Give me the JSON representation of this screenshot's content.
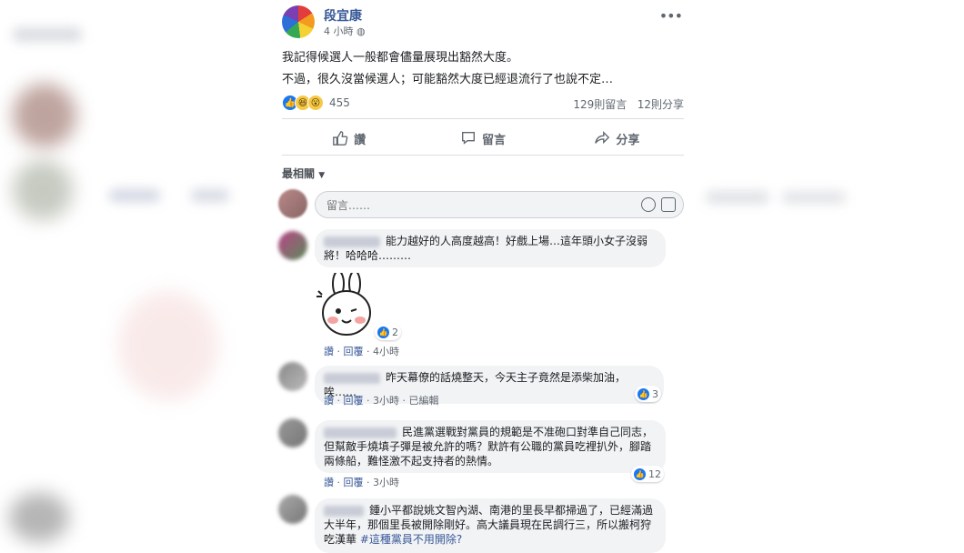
{
  "post": {
    "page_name": "段宜康",
    "time": "4 小時",
    "line1": "我記得候選人一般都會儘量展現出豁然大度。",
    "line2": "不過，很久沒當候選人；可能豁然大度已經退流行了也說不定…",
    "reaction_count": "455",
    "comments_count": "129則留言",
    "shares_count": "12則分享"
  },
  "actions": {
    "like": "讚",
    "comment": "留言",
    "share": "分享"
  },
  "sort_label": "最相關",
  "composer": {
    "placeholder": "留言……"
  },
  "comments": [
    {
      "text": "能力越好的人高度越高！好戲上場…這年頭小女子沒弱將！哈哈哈………",
      "sticker": true,
      "likes": "2",
      "like": "讚",
      "reply": "回覆",
      "time": "4小時"
    },
    {
      "text": "昨天幕僚的話燒整天，今天主子竟然是添柴加油，唉……",
      "likes": "3",
      "like": "讚",
      "reply": "回覆",
      "time": "3小時",
      "edited": "已編輯"
    },
    {
      "text": "民進黨選戰對黨員的規範是不准砲口對準自己同志，但幫敵手燒填子彈是被允許的嗎？默許有公職的黨員吃裡扒外，腳踏兩條船，難怪激不起支持者的熱情。",
      "likes": "12",
      "like": "讚",
      "reply": "回覆",
      "time": "3小時"
    },
    {
      "text": "鍾小平都說姚文智內湖、南港的里長早都掃過了，已經滿過大半年，那個里長被開除剛好。高大議員現在民調行三，所以搬柯狩吃漢華",
      "tag": "#這種黨員不用開除?"
    }
  ],
  "colors": {
    "link": "#385898",
    "like_blue": "#1877f2",
    "bubble": "#f2f3f5",
    "muted": "#606770"
  },
  "icons": [
    "more-icon",
    "like-icon",
    "comment-icon",
    "share-icon",
    "caret-down-icon",
    "emoji-icon",
    "sticker-icon"
  ]
}
